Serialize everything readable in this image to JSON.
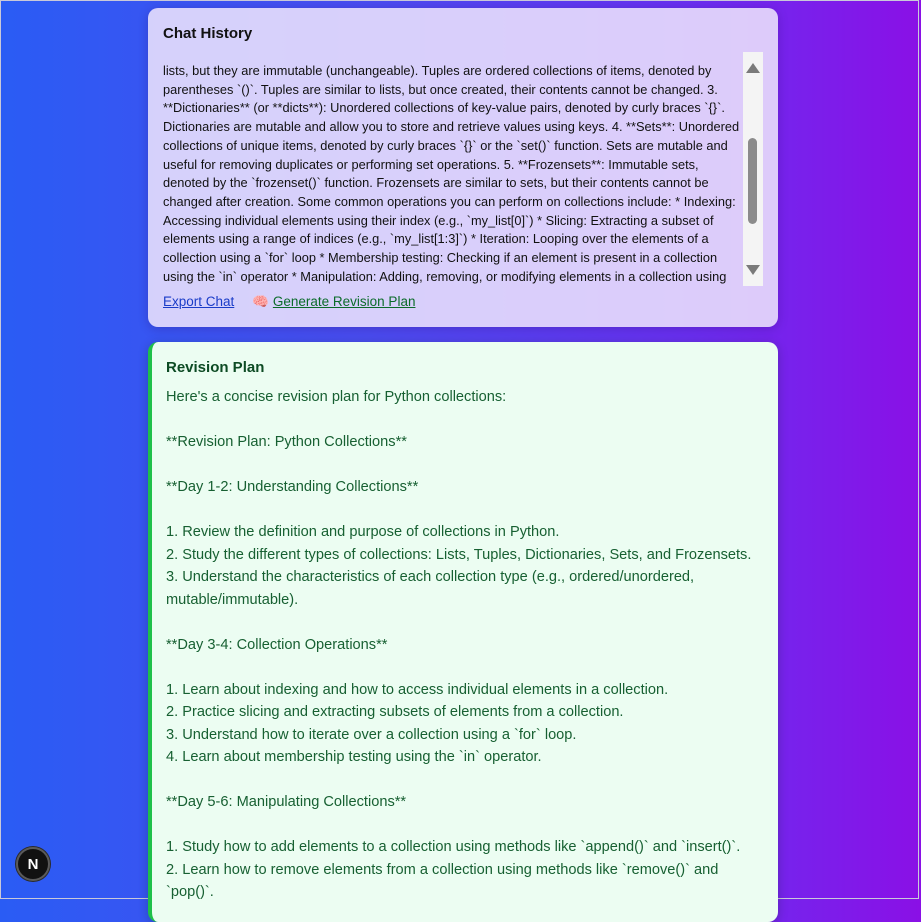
{
  "chat_history": {
    "title": "Chat History",
    "text": "lists, but they are immutable (unchangeable). Tuples are ordered collections of items, denoted by parentheses `()`. Tuples are similar to lists, but once created, their contents cannot be changed. 3. **Dictionaries** (or **dicts**): Unordered collections of key-value pairs, denoted by curly braces `{}`. Dictionaries are mutable and allow you to store and retrieve values using keys. 4. **Sets**: Unordered collections of unique items, denoted by curly braces `{}` or the `set()` function. Sets are mutable and useful for removing duplicates or performing set operations. 5. **Frozensets**: Immutable sets, denoted by the `frozenset()` function. Frozensets are similar to sets, but their contents cannot be changed after creation. Some common operations you can perform on collections include: * Indexing: Accessing individual elements using their index (e.g., `my_list[0]`) * Slicing: Extracting a subset of elements using a range of indices (e.g., `my_list[1:3]`) * Iteration: Looping over the elements of a collection using a `for` loop * Membership testing: Checking if an element is present in a collection using the `in` operator * Manipulation: Adding, removing, or modifying elements in a collection using various methods (e.g., `append()`, `insert()`, `remove()`)",
    "export_label": "Export Chat",
    "generate_label": "Generate Revision Plan",
    "generate_icon": "brain-icon"
  },
  "revision_plan": {
    "title": "Revision Plan",
    "lines": [
      "Here's a concise revision plan for Python collections:",
      "",
      "**Revision Plan: Python Collections**",
      "",
      "**Day 1-2: Understanding Collections**",
      "",
      "1. Review the definition and purpose of collections in Python.",
      "2. Study the different types of collections: Lists, Tuples, Dictionaries, Sets, and Frozensets.",
      "3. Understand the characteristics of each collection type (e.g., ordered/unordered, mutable/immutable).",
      "",
      "**Day 3-4: Collection Operations**",
      "",
      "1. Learn about indexing and how to access individual elements in a collection.",
      "2. Practice slicing and extracting subsets of elements from a collection.",
      "3. Understand how to iterate over a collection using a `for` loop.",
      "4. Learn about membership testing using the `in` operator.",
      "",
      "**Day 5-6: Manipulating Collections**",
      "",
      "1. Study how to add elements to a collection using methods like `append()` and `insert()`.",
      "2. Learn how to remove elements from a collection using methods like `remove()` and `pop()`."
    ]
  },
  "badge": {
    "letter": "N",
    "icon": "next-logo-icon"
  }
}
